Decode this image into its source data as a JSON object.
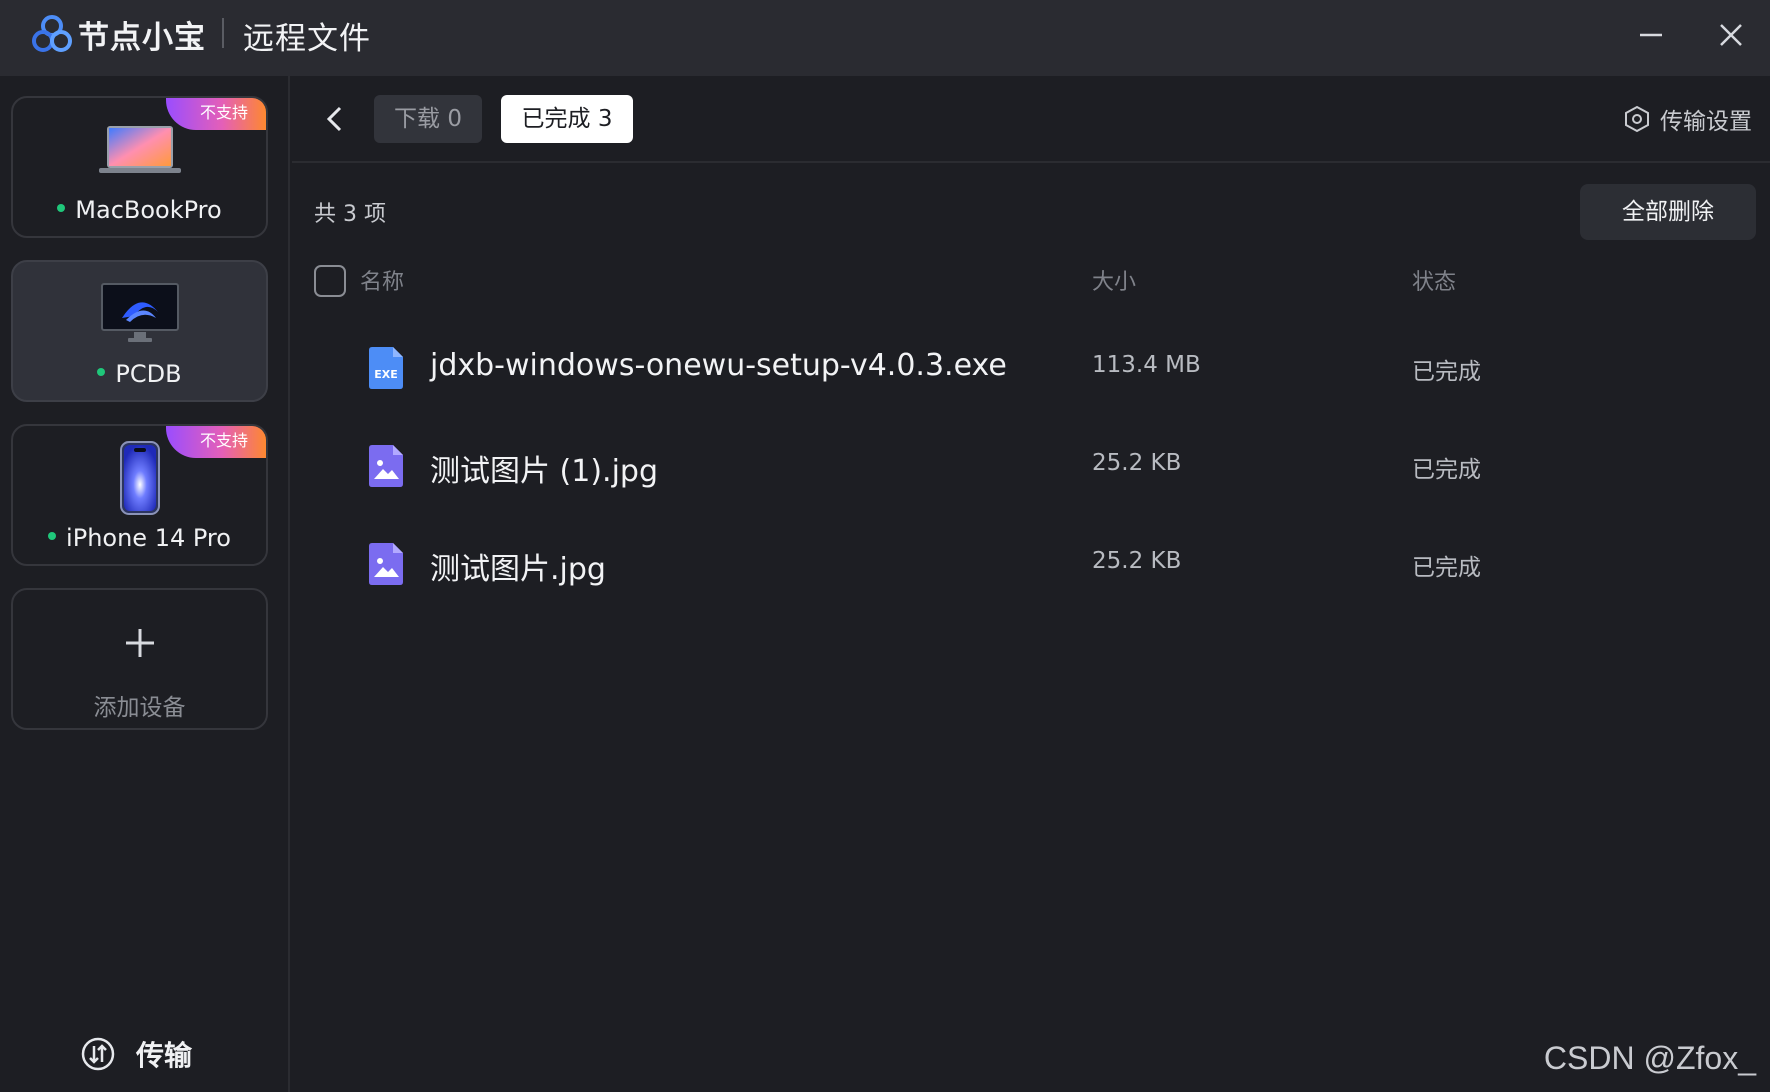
{
  "titlebar": {
    "app_name": "节点小宝",
    "page_title": "远程文件"
  },
  "sidebar": {
    "devices": [
      {
        "name": "MacBookPro",
        "badge": "不支持",
        "online": true,
        "active": false
      },
      {
        "name": "PCDB",
        "badge": "",
        "online": true,
        "active": true
      },
      {
        "name": "iPhone 14 Pro",
        "badge": "不支持",
        "online": true,
        "active": false
      }
    ],
    "add_device_label": "添加设备",
    "transfer_label": "传输"
  },
  "toolbar": {
    "tabs": [
      {
        "label": "下载 0",
        "selected": false
      },
      {
        "label": "已完成 3",
        "selected": true
      }
    ],
    "settings_label": "传输设置"
  },
  "list": {
    "count_text": "共 3 项",
    "delete_all_label": "全部删除",
    "columns": {
      "name": "名称",
      "size": "大小",
      "status": "状态"
    },
    "rows": [
      {
        "icon": "exe-file-icon",
        "name": "jdxb-windows-onewu-setup-v4.0.3.exe",
        "size": "113.4 MB",
        "status": "已完成"
      },
      {
        "icon": "image-file-icon",
        "name": "测试图片 (1).jpg",
        "size": "25.2 KB",
        "status": "已完成"
      },
      {
        "icon": "image-file-icon",
        "name": "测试图片.jpg",
        "size": "25.2 KB",
        "status": "已完成"
      }
    ]
  },
  "colors": {
    "background": "#1d1e23",
    "titlebar": "#2a2b31",
    "accent_badge_start": "#9a4dff",
    "accent_badge_end": "#ff8a2a",
    "online_dot": "#1fc77a",
    "file_icon_blue": "#4d8df6",
    "file_icon_purple": "#7b6cf0"
  },
  "watermark": "CSDN @Zfox_"
}
